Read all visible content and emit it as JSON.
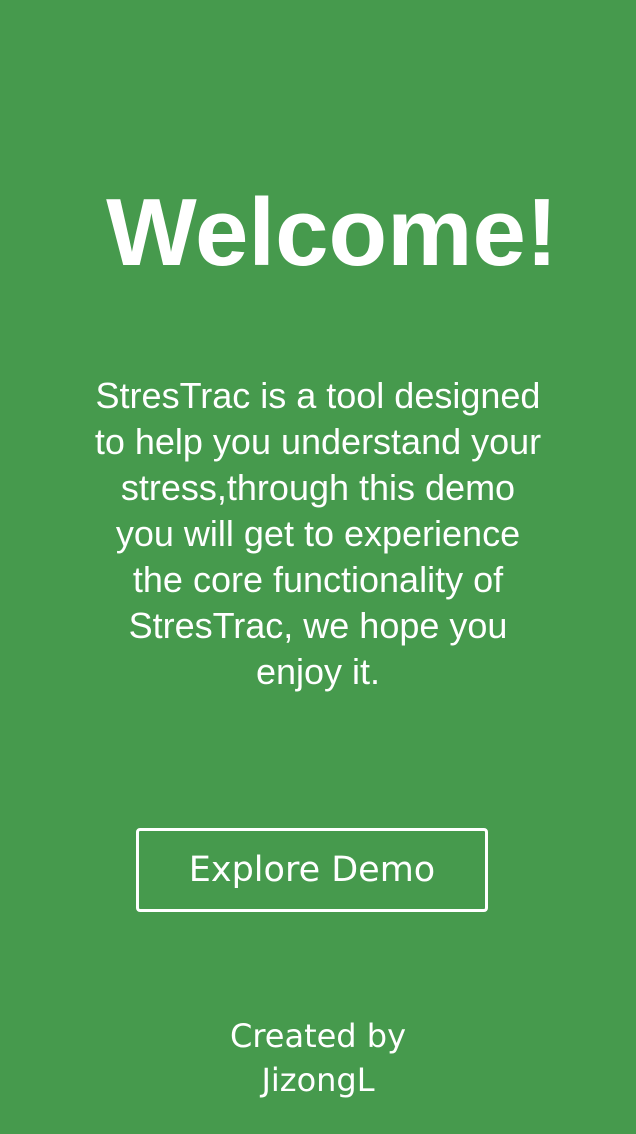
{
  "welcome": {
    "title": "Welcome!",
    "description": "StresTrac is a tool designed to help you understand your stress,through this demo you will get to experience the core functionality of StresTrac, we hope you enjoy it."
  },
  "actions": {
    "explore_label": "Explore Demo"
  },
  "footer": {
    "line1": "Created by",
    "line2": "JizongL"
  },
  "colors": {
    "background": "#469a4d",
    "text": "#ffffff"
  }
}
